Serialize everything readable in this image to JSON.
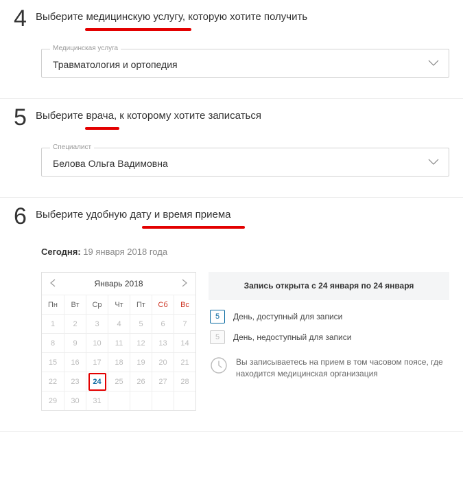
{
  "step4": {
    "num": "4",
    "title": "Выберите медицинскую услугу, которую хотите получить",
    "select_label": "Медицинская услуга",
    "select_value": "Травматология и ортопедия"
  },
  "step5": {
    "num": "5",
    "title": "Выберите врача, к которому хотите записаться",
    "select_label": "Специалист",
    "select_value": "Белова Ольга Вадимовна"
  },
  "step6": {
    "num": "6",
    "title": "Выберите удобную дату и время приема",
    "today_label": "Сегодня:",
    "today_date": "19 января 2018 года"
  },
  "calendar": {
    "month": "Январь 2018",
    "dh": [
      "Пн",
      "Вт",
      "Ср",
      "Чт",
      "Пт",
      "Сб",
      "Вс"
    ],
    "rows": [
      [
        "1",
        "2",
        "3",
        "4",
        "5",
        "6",
        "7"
      ],
      [
        "8",
        "9",
        "10",
        "11",
        "12",
        "13",
        "14"
      ],
      [
        "15",
        "16",
        "17",
        "18",
        "19",
        "20",
        "21"
      ],
      [
        "22",
        "23",
        "24",
        "25",
        "26",
        "27",
        "28"
      ],
      [
        "29",
        "30",
        "31",
        "",
        "",
        "",
        ""
      ]
    ],
    "selected": "24"
  },
  "info": {
    "open_text": "Запись открыта с 24 января по 24 января",
    "avail_chip": "5",
    "avail_text": "День, доступный для записи",
    "unavail_chip": "5",
    "unavail_text": "День, недоступный для записи",
    "tz_text": "Вы записываетесь на прием в том часовом поясе, где находится медицинская организация"
  }
}
